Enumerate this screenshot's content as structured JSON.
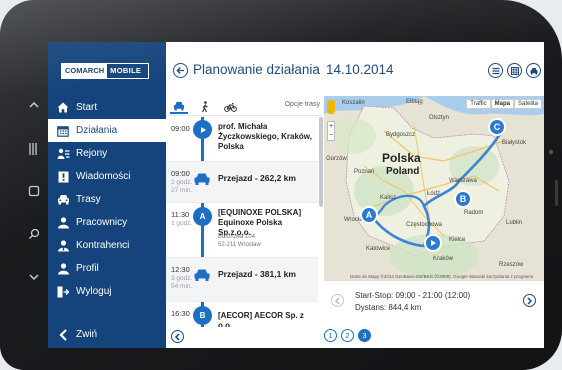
{
  "app": {
    "logo_left": "COMARCH",
    "logo_right": "MOBILE",
    "title": "Planowanie działania",
    "date": "14.10.2014"
  },
  "sidebar": {
    "items": [
      {
        "label": "Start",
        "icon": "home-icon"
      },
      {
        "label": "Działania",
        "icon": "calendar-icon",
        "active": true
      },
      {
        "label": "Rejony",
        "icon": "regions-icon"
      },
      {
        "label": "Wiadomości",
        "icon": "message-icon"
      },
      {
        "label": "Trasy",
        "icon": "car-icon"
      },
      {
        "label": "Pracownicy",
        "icon": "employees-icon"
      },
      {
        "label": "Kontrahenci",
        "icon": "contractors-icon"
      },
      {
        "label": "Profil",
        "icon": "profile-icon"
      },
      {
        "label": "Wyloguj",
        "icon": "logout-icon"
      }
    ],
    "collapse_label": "Zwiń"
  },
  "route_panel": {
    "options_label": "Opcje trasy",
    "entries": [
      {
        "time": "09:00",
        "marker": "",
        "name": "prof. Michała Życzkowskiego, Kraków, Polska"
      },
      {
        "time": "09:00",
        "duration": "2 godz. 27 min.",
        "segment": "Przejazd - 262,2 km"
      },
      {
        "time": "11:30",
        "duration": "1 godz.",
        "marker": "A",
        "name": "[EQUINOXE POLSKA] Equinoxe Polska Sp.z.o.o.",
        "addr1": "Buforowa 104",
        "addr2": "52-211 Wrocław"
      },
      {
        "time": "12:30",
        "duration": "3 godz. 54 min.",
        "segment": "Przejazd - 381,1 km"
      },
      {
        "time": "16:30",
        "marker": "B",
        "name": "[AECOR] AECOR Sp. z o.o."
      }
    ]
  },
  "map": {
    "country": "Polska",
    "country_en": "Poland",
    "map_type_map": "Mapa",
    "map_type_sat": "Satelita",
    "traffic": "Traffic",
    "credit": "Dane do Mapy ©2014 GeoBasis-DE/BKG (©2009), Google   Warunki korzystania z programu",
    "cities": [
      "Koszalin",
      "Elbląg",
      "Olsztyn",
      "Bydgoszcz",
      "Gorzów",
      "Poznań",
      "Kalisz",
      "Łódź",
      "Warszawa",
      "Białystok",
      "Radom",
      "Częstochowa",
      "Kielce",
      "Kraków",
      "Rzeszów",
      "Lublin",
      "Wrocław",
      "Katowice"
    ],
    "pins": [
      "A",
      "B",
      "C"
    ]
  },
  "summary": {
    "start_stop": "Start-Stop: 09:00 - 21:00 (12:00)",
    "distance": "Dystans: 844,4 km"
  },
  "pagination": [
    "1",
    "2",
    "3"
  ],
  "pagination_current": "3"
}
